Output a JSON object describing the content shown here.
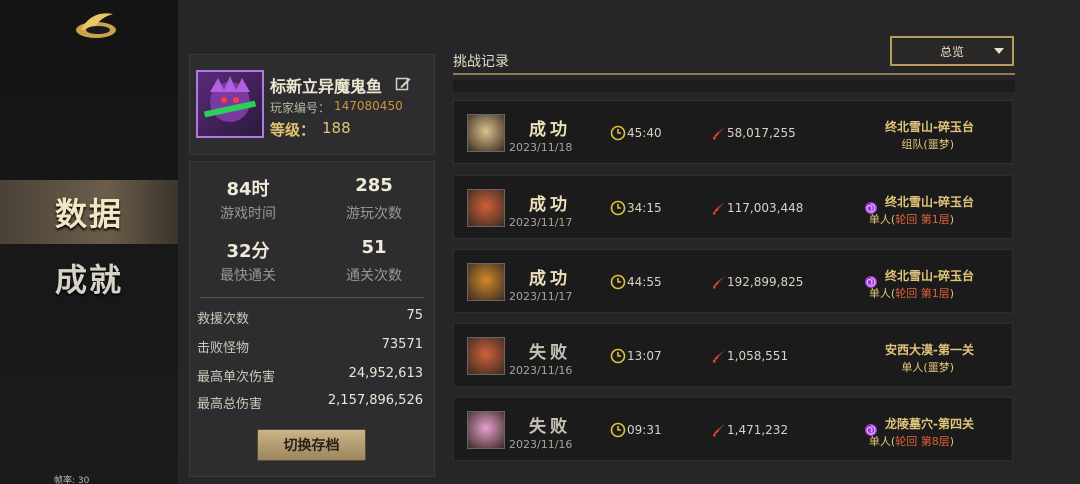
{
  "nav": {
    "items": [
      {
        "label": "数据",
        "active": true
      },
      {
        "label": "成就",
        "active": false
      }
    ]
  },
  "fps_label": "帧率: 30",
  "profile": {
    "name": "标新立异魔鬼鱼",
    "player_id_label": "玩家编号：",
    "player_id": "147080450",
    "level_label": "等级：",
    "level": "188"
  },
  "stats": {
    "grid": [
      {
        "value": "84时",
        "label": "游戏时间"
      },
      {
        "value": "285",
        "label": "游玩次数"
      },
      {
        "value": "32分",
        "label": "最快通关"
      },
      {
        "value": "51",
        "label": "通关次数"
      }
    ],
    "rows": [
      {
        "label": "救援次数",
        "value": "75"
      },
      {
        "label": "击败怪物",
        "value": "73571"
      },
      {
        "label": "最高单次伤害",
        "value": "24,952,613"
      },
      {
        "label": "最高总伤害",
        "value": "2,157,896,526"
      }
    ],
    "switch_button": "切换存档"
  },
  "records": {
    "title": "挑战记录",
    "filter": "总览",
    "items": [
      {
        "result": "成功",
        "date": "2023/11/18",
        "time": "45:40",
        "damage": "58,017,255",
        "stage": "终北雪山-碎玉台",
        "mode_prefix": "组队(",
        "mode_highlight": "",
        "mode_suffix": "噩梦)",
        "swirl": false,
        "avatar_color": "#d9c28a"
      },
      {
        "result": "成功",
        "date": "2023/11/17",
        "time": "34:15",
        "damage": "117,003,448",
        "stage": "终北雪山-碎玉台",
        "mode_prefix": "单人(",
        "mode_highlight": "轮回 第1层",
        "mode_suffix": ")",
        "swirl": true,
        "avatar_color": "#d0603a"
      },
      {
        "result": "成功",
        "date": "2023/11/17",
        "time": "44:55",
        "damage": "192,899,825",
        "stage": "终北雪山-碎玉台",
        "mode_prefix": "单人(",
        "mode_highlight": "轮回 第1层",
        "mode_suffix": ")",
        "swirl": true,
        "avatar_color": "#d08a2a"
      },
      {
        "result": "失败",
        "date": "2023/11/16",
        "time": "13:07",
        "damage": "1,058,551",
        "stage": "安西大漠-第一关",
        "mode_prefix": "单人(",
        "mode_highlight": "",
        "mode_suffix": "噩梦)",
        "swirl": false,
        "avatar_color": "#d0603a"
      },
      {
        "result": "失败",
        "date": "2023/11/16",
        "time": "09:31",
        "damage": "1,471,232",
        "stage": "龙陵墓穴-第四关",
        "mode_prefix": "单人(",
        "mode_highlight": "轮回 第8层",
        "mode_suffix": ")",
        "swirl": true,
        "avatar_color": "#e6a0d0"
      }
    ]
  },
  "colors": {
    "accent_gold": "#b89c5e",
    "stage_text": "#e2c57a",
    "highlight_red": "#e0603a",
    "swirl_purple": "#9a3ad0"
  }
}
